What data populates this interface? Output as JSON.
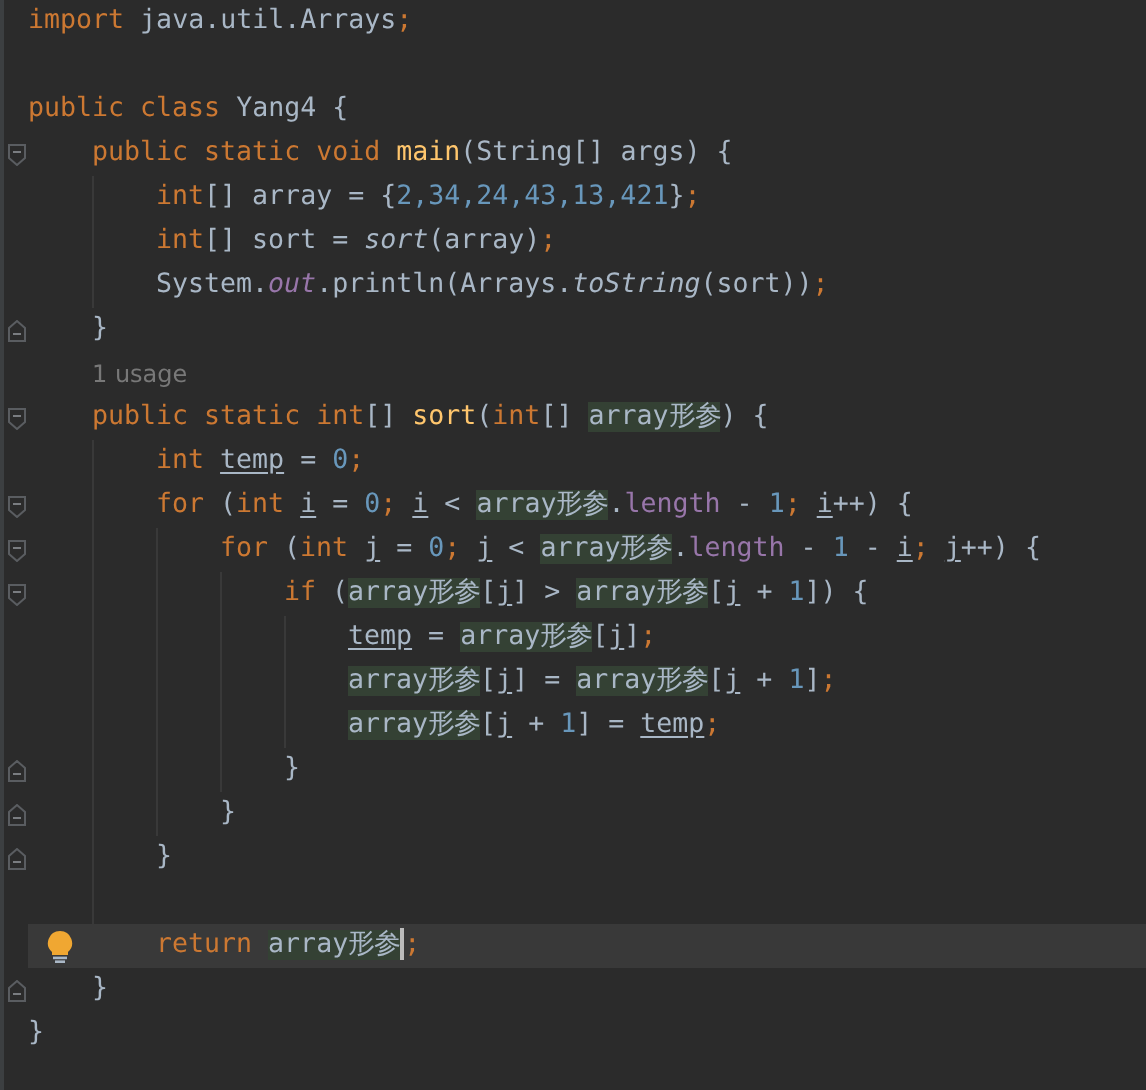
{
  "editor": {
    "lines": [
      {
        "opens_block": false,
        "closes_block": false,
        "tokens": [
          {
            "kind": "keyword",
            "text": "import"
          },
          {
            "kind": "plain",
            "text": " java.util.Arrays"
          },
          {
            "kind": "punct",
            "text": ";"
          }
        ]
      },
      {
        "opens_block": false,
        "closes_block": false
      },
      {
        "opens_block": false,
        "closes_block": false,
        "tokens": [
          {
            "kind": "keyword",
            "text": "public class "
          },
          {
            "kind": "plain",
            "text": "Yang4 {"
          }
        ],
        "children": [
          {
            "opens_block": true,
            "closes_block": false,
            "tokens": [
              {
                "kind": "keyword",
                "text": "public static void "
              },
              {
                "kind": "method",
                "text": "main"
              },
              {
                "kind": "plain",
                "text": "(String[] args) {"
              }
            ],
            "children": [
              {
                "opens_block": false,
                "closes_block": false,
                "tokens": [
                  {
                    "kind": "keyword",
                    "text": "int"
                  },
                  {
                    "kind": "plain",
                    "text": "[] array = {"
                  },
                  {
                    "kind": "number",
                    "text": "2,34,24,43,13,421"
                  },
                  {
                    "kind": "plain",
                    "text": "}"
                  },
                  {
                    "kind": "punct",
                    "text": ";"
                  }
                ]
              },
              {
                "opens_block": false,
                "closes_block": false,
                "tokens": [
                  {
                    "kind": "keyword",
                    "text": "int"
                  },
                  {
                    "kind": "plain",
                    "text": "[] sort = "
                  },
                  {
                    "kind": "static-call",
                    "text": "sort"
                  },
                  {
                    "kind": "plain",
                    "text": "(array)"
                  },
                  {
                    "kind": "punct",
                    "text": ";"
                  }
                ]
              },
              {
                "opens_block": false,
                "closes_block": false,
                "tokens": [
                  {
                    "kind": "plain",
                    "text": "System."
                  },
                  {
                    "kind": "static-field",
                    "text": "out"
                  },
                  {
                    "kind": "plain",
                    "text": ".println(Arrays."
                  },
                  {
                    "kind": "static-call",
                    "text": "toString"
                  },
                  {
                    "kind": "plain",
                    "text": "(sort))"
                  },
                  {
                    "kind": "punct",
                    "text": ";"
                  }
                ]
              }
            ]
          },
          {
            "opens_block": false,
            "closes_block": true,
            "tokens": [
              {
                "kind": "plain",
                "text": "}"
              }
            ]
          },
          {
            "opens_block": false,
            "closes_block": false,
            "tokens": [
              {
                "kind": "hint",
                "text": "1 usage"
              }
            ]
          },
          {
            "opens_block": true,
            "closes_block": false,
            "tokens": [
              {
                "kind": "keyword",
                "text": "public static int"
              },
              {
                "kind": "plain",
                "text": "[] "
              },
              {
                "kind": "method",
                "text": "sort"
              },
              {
                "kind": "plain",
                "text": "("
              },
              {
                "kind": "keyword",
                "text": "int"
              },
              {
                "kind": "plain",
                "text": "[] "
              },
              {
                "kind": "param",
                "text": "array形参"
              },
              {
                "kind": "plain",
                "text": ") {"
              }
            ],
            "children": [
              {
                "opens_block": false,
                "closes_block": false,
                "tokens": [
                  {
                    "kind": "keyword",
                    "text": "int "
                  },
                  {
                    "kind": "var",
                    "text": "temp"
                  },
                  {
                    "kind": "plain",
                    "text": " = "
                  },
                  {
                    "kind": "number",
                    "text": "0"
                  },
                  {
                    "kind": "punct",
                    "text": ";"
                  }
                ]
              },
              {
                "opens_block": true,
                "closes_block": false,
                "tokens": [
                  {
                    "kind": "keyword",
                    "text": "for "
                  },
                  {
                    "kind": "plain",
                    "text": "("
                  },
                  {
                    "kind": "keyword",
                    "text": "int "
                  },
                  {
                    "kind": "var",
                    "text": "i"
                  },
                  {
                    "kind": "plain",
                    "text": " = "
                  },
                  {
                    "kind": "number",
                    "text": "0"
                  },
                  {
                    "kind": "punct",
                    "text": "; "
                  },
                  {
                    "kind": "var",
                    "text": "i"
                  },
                  {
                    "kind": "plain",
                    "text": " < "
                  },
                  {
                    "kind": "param",
                    "text": "array形参"
                  },
                  {
                    "kind": "plain",
                    "text": "."
                  },
                  {
                    "kind": "field",
                    "text": "length"
                  },
                  {
                    "kind": "plain",
                    "text": " - "
                  },
                  {
                    "kind": "number",
                    "text": "1"
                  },
                  {
                    "kind": "punct",
                    "text": "; "
                  },
                  {
                    "kind": "var",
                    "text": "i"
                  },
                  {
                    "kind": "plain",
                    "text": "++) {"
                  }
                ],
                "children": [
                  {
                    "opens_block": true,
                    "closes_block": false,
                    "tokens": [
                      {
                        "kind": "keyword",
                        "text": "for "
                      },
                      {
                        "kind": "plain",
                        "text": "("
                      },
                      {
                        "kind": "keyword",
                        "text": "int "
                      },
                      {
                        "kind": "var",
                        "text": "j"
                      },
                      {
                        "kind": "plain",
                        "text": " = "
                      },
                      {
                        "kind": "number",
                        "text": "0"
                      },
                      {
                        "kind": "punct",
                        "text": "; "
                      },
                      {
                        "kind": "var",
                        "text": "j"
                      },
                      {
                        "kind": "plain",
                        "text": " < "
                      },
                      {
                        "kind": "param",
                        "text": "array形参"
                      },
                      {
                        "kind": "plain",
                        "text": "."
                      },
                      {
                        "kind": "field",
                        "text": "length"
                      },
                      {
                        "kind": "plain",
                        "text": " - "
                      },
                      {
                        "kind": "number",
                        "text": "1"
                      },
                      {
                        "kind": "plain",
                        "text": " - "
                      },
                      {
                        "kind": "var",
                        "text": "i"
                      },
                      {
                        "kind": "punct",
                        "text": "; "
                      },
                      {
                        "kind": "var",
                        "text": "j"
                      },
                      {
                        "kind": "plain",
                        "text": "++) {"
                      }
                    ],
                    "children": [
                      {
                        "opens_block": true,
                        "closes_block": false,
                        "tokens": [
                          {
                            "kind": "keyword",
                            "text": "if "
                          },
                          {
                            "kind": "plain",
                            "text": "("
                          },
                          {
                            "kind": "param",
                            "text": "array形参"
                          },
                          {
                            "kind": "plain",
                            "text": "["
                          },
                          {
                            "kind": "var",
                            "text": "j"
                          },
                          {
                            "kind": "plain",
                            "text": "] > "
                          },
                          {
                            "kind": "param",
                            "text": "array形参"
                          },
                          {
                            "kind": "plain",
                            "text": "["
                          },
                          {
                            "kind": "var",
                            "text": "j"
                          },
                          {
                            "kind": "plain",
                            "text": " + "
                          },
                          {
                            "kind": "number",
                            "text": "1"
                          },
                          {
                            "kind": "plain",
                            "text": "]) {"
                          }
                        ],
                        "children": [
                          {
                            "opens_block": false,
                            "closes_block": false,
                            "tokens": [
                              {
                                "kind": "var",
                                "text": "temp"
                              },
                              {
                                "kind": "plain",
                                "text": " = "
                              },
                              {
                                "kind": "param",
                                "text": "array形参"
                              },
                              {
                                "kind": "plain",
                                "text": "["
                              },
                              {
                                "kind": "var",
                                "text": "j"
                              },
                              {
                                "kind": "plain",
                                "text": "]"
                              },
                              {
                                "kind": "punct",
                                "text": ";"
                              }
                            ]
                          },
                          {
                            "opens_block": false,
                            "closes_block": false,
                            "tokens": [
                              {
                                "kind": "param",
                                "text": "array形参"
                              },
                              {
                                "kind": "plain",
                                "text": "["
                              },
                              {
                                "kind": "var",
                                "text": "j"
                              },
                              {
                                "kind": "plain",
                                "text": "] = "
                              },
                              {
                                "kind": "param",
                                "text": "array形参"
                              },
                              {
                                "kind": "plain",
                                "text": "["
                              },
                              {
                                "kind": "var",
                                "text": "j"
                              },
                              {
                                "kind": "plain",
                                "text": " + "
                              },
                              {
                                "kind": "number",
                                "text": "1"
                              },
                              {
                                "kind": "plain",
                                "text": "]"
                              },
                              {
                                "kind": "punct",
                                "text": ";"
                              }
                            ]
                          },
                          {
                            "opens_block": false,
                            "closes_block": false,
                            "tokens": [
                              {
                                "kind": "param",
                                "text": "array形参"
                              },
                              {
                                "kind": "plain",
                                "text": "["
                              },
                              {
                                "kind": "var",
                                "text": "j"
                              },
                              {
                                "kind": "plain",
                                "text": " + "
                              },
                              {
                                "kind": "number",
                                "text": "1"
                              },
                              {
                                "kind": "plain",
                                "text": "] = "
                              },
                              {
                                "kind": "var",
                                "text": "temp"
                              },
                              {
                                "kind": "punct",
                                "text": ";"
                              }
                            ]
                          }
                        ]
                      },
                      {
                        "opens_block": false,
                        "closes_block": true,
                        "tokens": [
                          {
                            "kind": "plain",
                            "text": "}"
                          }
                        ]
                      }
                    ]
                  },
                  {
                    "opens_block": false,
                    "closes_block": true,
                    "tokens": [
                      {
                        "kind": "plain",
                        "text": "}"
                      }
                    ]
                  }
                ]
              },
              {
                "opens_block": false,
                "closes_block": true,
                "tokens": [
                  {
                    "kind": "plain",
                    "text": "}"
                  }
                ]
              },
              {
                "opens_block": false,
                "closes_block": false
              },
              {
                "opens_block": false,
                "closes_block": false,
                "current": true,
                "bulb": true,
                "tokens": [
                  {
                    "kind": "keyword",
                    "text": "return "
                  },
                  {
                    "kind": "param",
                    "text": "array形参",
                    "caret": true
                  },
                  {
                    "kind": "punct",
                    "text": ";"
                  }
                ]
              }
            ]
          },
          {
            "opens_block": false,
            "closes_block": true,
            "tokens": [
              {
                "kind": "plain",
                "text": "}"
              }
            ]
          }
        ]
      },
      {
        "opens_block": false,
        "closes_block": false,
        "tokens": [
          {
            "kind": "plain",
            "text": "}"
          }
        ]
      }
    ]
  }
}
